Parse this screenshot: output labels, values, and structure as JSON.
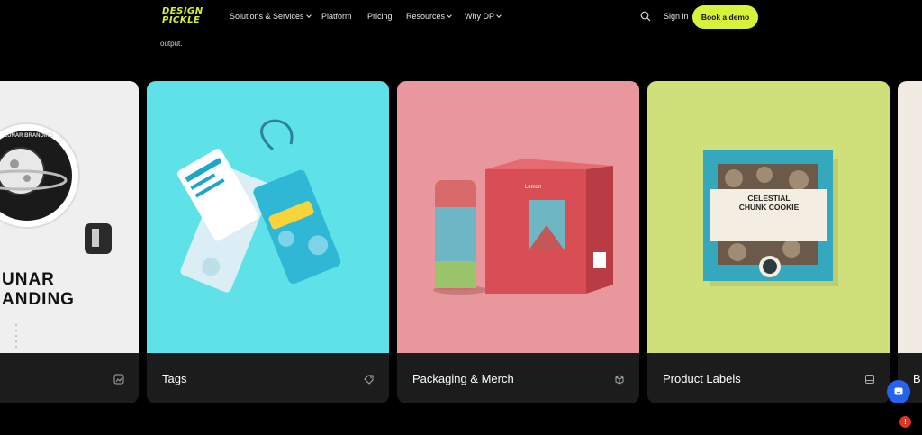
{
  "colors": {
    "brand_lime": "#d7f23a",
    "background": "#000000",
    "card_footer": "#1c1c1c",
    "tags_bg": "#5ee1e7",
    "packaging_bg": "#e8989c",
    "labels_bg": "#cfe07a",
    "chat_blue": "#2563eb",
    "notif_red": "#e0342a"
  },
  "header": {
    "logo_line1": "DESIGN",
    "logo_line2": "PICKLE",
    "nav": [
      {
        "label": "Solutions & Services",
        "dropdown": true
      },
      {
        "label": "Platform",
        "dropdown": false
      },
      {
        "label": "Pricing",
        "dropdown": false
      },
      {
        "label": "Resources",
        "dropdown": true
      },
      {
        "label": "Why DP",
        "dropdown": true
      }
    ],
    "signin_label": "Sign in",
    "cta_label": "Book a demo"
  },
  "intro_fragment": "output.",
  "cards": [
    {
      "label": "",
      "image_text_1": "UNAR",
      "image_text_2": "ANDING",
      "badge_text": "LUNAR BRANDING",
      "icon": "image-icon"
    },
    {
      "label": "Tags",
      "icon": "tag-icon"
    },
    {
      "label": "Packaging & Merch",
      "icon": "box-icon",
      "box_text": "Lemon"
    },
    {
      "label": "Product Labels",
      "icon": "label-icon",
      "product_title_1": "CELESTIAL",
      "product_title_2": "CHUNK",
      "product_title_3": "COOKIE"
    },
    {
      "label": "B",
      "icon": ""
    }
  ],
  "notification_count": "!"
}
